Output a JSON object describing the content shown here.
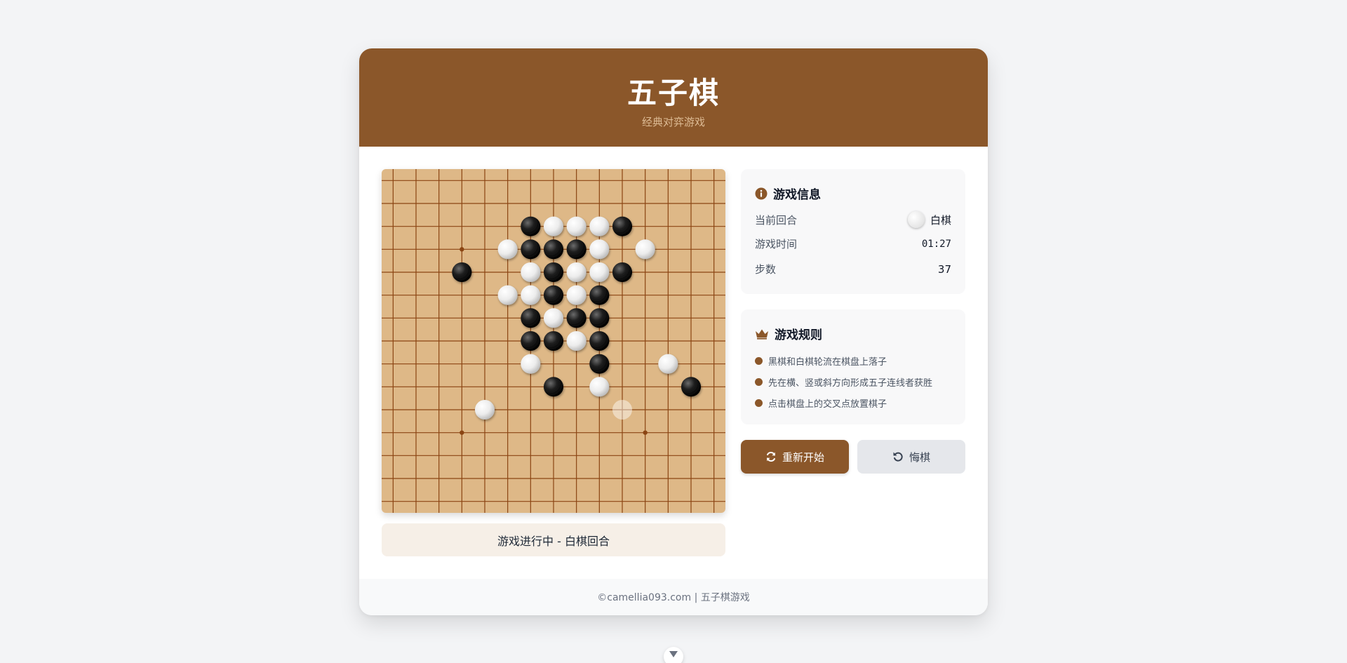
{
  "header": {
    "title": "五子棋",
    "subtitle": "经典对弈游戏"
  },
  "board": {
    "size": 15,
    "star_points": [
      [
        3,
        3
      ],
      [
        3,
        11
      ],
      [
        11,
        3
      ],
      [
        11,
        11
      ]
    ],
    "stones": [
      {
        "row": 2,
        "col": 6,
        "color": "black"
      },
      {
        "row": 2,
        "col": 7,
        "color": "white"
      },
      {
        "row": 2,
        "col": 8,
        "color": "white"
      },
      {
        "row": 2,
        "col": 9,
        "color": "white"
      },
      {
        "row": 2,
        "col": 10,
        "color": "black"
      },
      {
        "row": 3,
        "col": 5,
        "color": "white"
      },
      {
        "row": 3,
        "col": 6,
        "color": "black"
      },
      {
        "row": 3,
        "col": 7,
        "color": "black"
      },
      {
        "row": 3,
        "col": 8,
        "color": "black"
      },
      {
        "row": 3,
        "col": 9,
        "color": "white"
      },
      {
        "row": 3,
        "col": 11,
        "color": "white"
      },
      {
        "row": 4,
        "col": 3,
        "color": "black"
      },
      {
        "row": 4,
        "col": 6,
        "color": "white"
      },
      {
        "row": 4,
        "col": 7,
        "color": "black"
      },
      {
        "row": 4,
        "col": 8,
        "color": "white"
      },
      {
        "row": 4,
        "col": 9,
        "color": "white"
      },
      {
        "row": 4,
        "col": 10,
        "color": "black"
      },
      {
        "row": 5,
        "col": 5,
        "color": "white"
      },
      {
        "row": 5,
        "col": 6,
        "color": "white"
      },
      {
        "row": 5,
        "col": 7,
        "color": "black"
      },
      {
        "row": 5,
        "col": 8,
        "color": "white"
      },
      {
        "row": 5,
        "col": 9,
        "color": "black"
      },
      {
        "row": 6,
        "col": 6,
        "color": "black"
      },
      {
        "row": 6,
        "col": 7,
        "color": "white"
      },
      {
        "row": 6,
        "col": 8,
        "color": "black"
      },
      {
        "row": 6,
        "col": 9,
        "color": "black"
      },
      {
        "row": 7,
        "col": 6,
        "color": "black"
      },
      {
        "row": 7,
        "col": 7,
        "color": "black"
      },
      {
        "row": 7,
        "col": 8,
        "color": "white"
      },
      {
        "row": 7,
        "col": 9,
        "color": "black"
      },
      {
        "row": 8,
        "col": 6,
        "color": "white"
      },
      {
        "row": 8,
        "col": 9,
        "color": "black"
      },
      {
        "row": 8,
        "col": 12,
        "color": "white"
      },
      {
        "row": 9,
        "col": 7,
        "color": "black"
      },
      {
        "row": 9,
        "col": 9,
        "color": "white"
      },
      {
        "row": 9,
        "col": 13,
        "color": "black"
      },
      {
        "row": 10,
        "col": 4,
        "color": "white"
      }
    ],
    "hover_stone": {
      "row": 10,
      "col": 10,
      "color": "white"
    }
  },
  "status": {
    "text": "游戏进行中 - 白棋回合"
  },
  "info": {
    "heading": "游戏信息",
    "turn_label": "当前回合",
    "turn_value": "白棋",
    "time_label": "游戏时间",
    "time_value": "01:27",
    "moves_label": "步数",
    "moves_value": "37"
  },
  "rules": {
    "heading": "游戏规则",
    "items": [
      "黑棋和白棋轮流在棋盘上落子",
      "先在横、竖或斜方向形成五子连线者获胜",
      "点击棋盘上的交叉点放置棋子"
    ]
  },
  "buttons": {
    "restart": "重新开始",
    "undo": "悔棋"
  },
  "footer": {
    "text": "©camellia093.com | 五子棋游戏"
  },
  "colors": {
    "brand": "#8b572a",
    "board": "#deb887",
    "grid_line": "#8b4513"
  },
  "icons": {
    "info": "info-circle-icon",
    "rules": "crown-icon",
    "restart": "refresh-icon",
    "undo": "undo-icon",
    "scroll": "chevron-down-icon"
  }
}
